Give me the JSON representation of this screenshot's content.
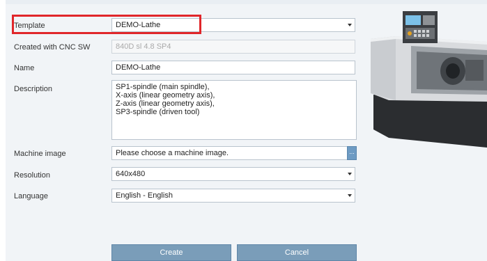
{
  "form": {
    "template": {
      "label": "Template",
      "value": "DEMO-Lathe"
    },
    "created_with": {
      "label": "Created with CNC SW",
      "value": "840D sl 4.8 SP4"
    },
    "name": {
      "label": "Name",
      "value": "DEMO-Lathe"
    },
    "description": {
      "label": "Description",
      "lines": [
        "SP1-spindle (main spindle),",
        "X-axis (linear geometry axis),",
        "Z-axis (linear geometry axis),",
        "SP3-spindle (driven tool)"
      ]
    },
    "machine_image": {
      "label": "Machine image",
      "value": "Please choose a machine image.",
      "browse_label": "..."
    },
    "resolution": {
      "label": "Resolution",
      "value": "640x480"
    },
    "language": {
      "label": "Language",
      "value": "English - English"
    }
  },
  "buttons": {
    "create": "Create",
    "cancel": "Cancel"
  },
  "colors": {
    "highlight": "#e0262a",
    "button": "#7a9db9",
    "panel": "#f1f4f7"
  },
  "icons": {
    "machine_preview": "cnc-lathe-machine-illustration"
  }
}
